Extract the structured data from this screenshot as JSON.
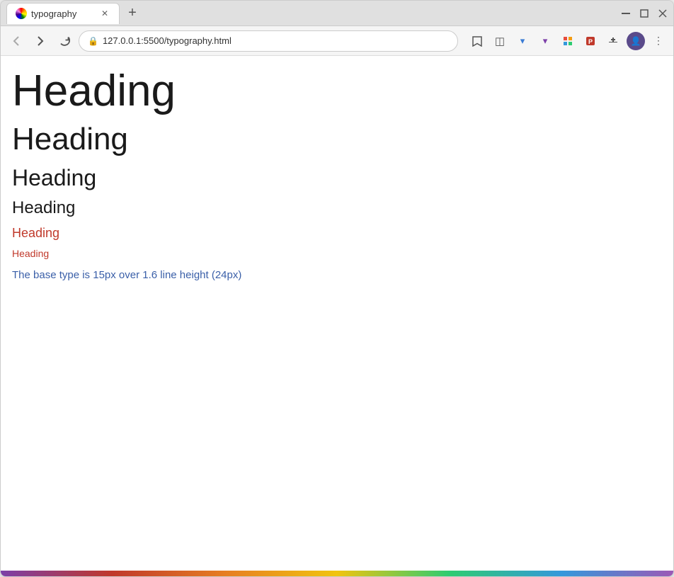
{
  "browser": {
    "title": "typography",
    "url": "127.0.0.1:5500/typography.html",
    "tab_label": "typography"
  },
  "nav": {
    "back": "‹",
    "forward": "›",
    "reload": "↺",
    "lock": "🔒",
    "star": "☆",
    "more": "⋮"
  },
  "window_controls": {
    "minimize": "–",
    "maximize": "▢",
    "close": "✕",
    "restore": "❐"
  },
  "headings": [
    {
      "text": "Heading",
      "level": "h1"
    },
    {
      "text": "Heading",
      "level": "h2"
    },
    {
      "text": "Heading",
      "level": "h3"
    },
    {
      "text": "Heading",
      "level": "h4"
    },
    {
      "text": "Heading",
      "level": "h5"
    },
    {
      "text": "Heading",
      "level": "h6"
    }
  ],
  "body_text": "The base type is 15px over 1.6 line height (24px)"
}
